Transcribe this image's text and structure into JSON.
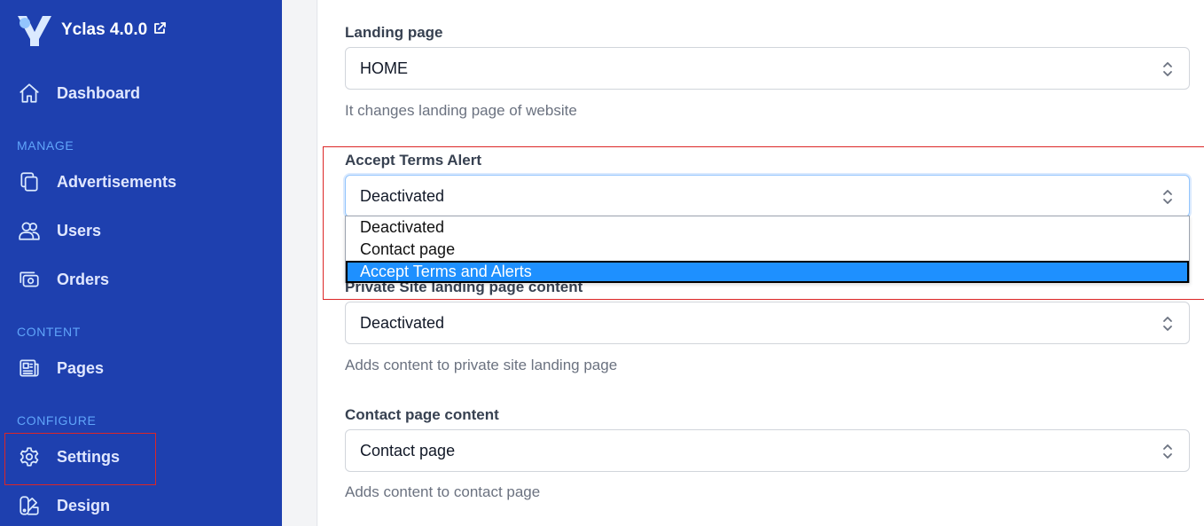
{
  "brand": {
    "name": "Yclas 4.0.0",
    "logo_icon": "yclas-logo-icon",
    "external_icon": "external-link-icon"
  },
  "sidebar": {
    "dashboard": {
      "label": "Dashboard",
      "icon": "home-icon"
    },
    "sections": {
      "manage": "MANAGE",
      "content": "CONTENT",
      "configure": "CONFIGURE"
    },
    "items": [
      {
        "label": "Advertisements",
        "icon": "copy-icon"
      },
      {
        "label": "Users",
        "icon": "users-icon"
      },
      {
        "label": "Orders",
        "icon": "cash-icon"
      },
      {
        "label": "Pages",
        "icon": "newspaper-icon"
      },
      {
        "label": "Settings",
        "icon": "gear-icon"
      },
      {
        "label": "Design",
        "icon": "color-swatch-icon"
      }
    ]
  },
  "form": {
    "landing": {
      "label": "Landing page",
      "value": "HOME",
      "help": "It changes landing page of website"
    },
    "terms": {
      "label": "Accept Terms Alert",
      "value": "Deactivated",
      "options": [
        "Deactivated",
        "Contact page",
        "Accept Terms and Alerts"
      ],
      "selected_index": 2
    },
    "private_site": {
      "label": "Private Site landing page content",
      "value": "Deactivated",
      "help": "Adds content to private site landing page"
    },
    "contact": {
      "label": "Contact page content",
      "value": "Contact page",
      "help": "Adds content to contact page"
    }
  },
  "colors": {
    "sidebar_bg": "#1e40af",
    "section_label": "#60a5fa",
    "highlight": "#dc2626",
    "option_selected": "#1e90ff"
  }
}
